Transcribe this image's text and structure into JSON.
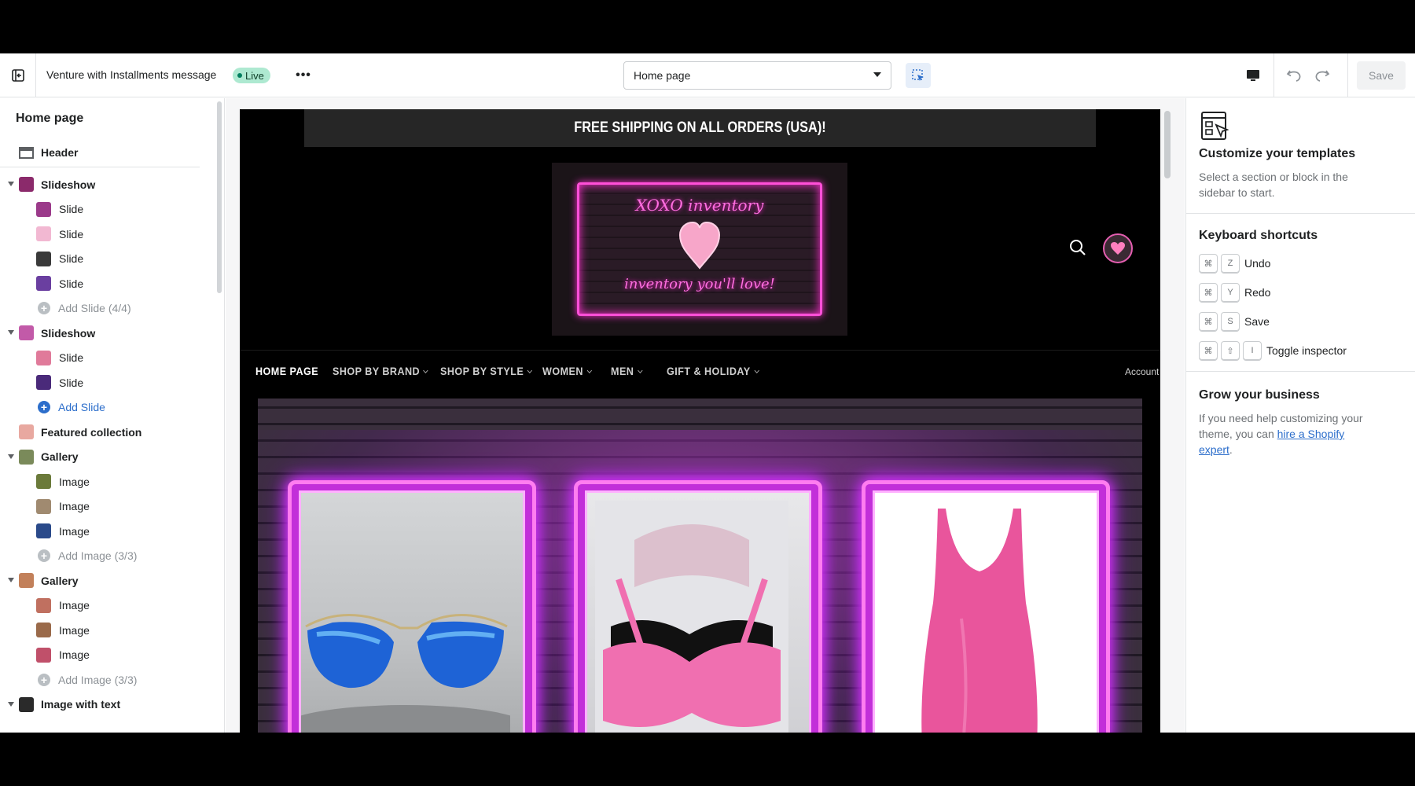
{
  "topbar": {
    "theme_name": "Venture with Installments message",
    "live_label": "Live",
    "more_label": "•••",
    "page_select_value": "Home page",
    "save_label": "Save"
  },
  "sidebar": {
    "title": "Home page",
    "header_label": "Header",
    "rows": [
      {
        "kind": "section",
        "label": "Slideshow",
        "thumb": "#8b2a6b"
      },
      {
        "kind": "child",
        "label": "Slide",
        "thumb": "#9b3a8a"
      },
      {
        "kind": "child",
        "label": "Slide",
        "thumb": "#f2b8d2"
      },
      {
        "kind": "child",
        "label": "Slide",
        "thumb": "#3a3a3a"
      },
      {
        "kind": "child",
        "label": "Slide",
        "thumb": "#6a3fa0"
      },
      {
        "kind": "add",
        "label": "Add Slide (4/4)"
      },
      {
        "kind": "section",
        "label": "Slideshow",
        "thumb": "#c25aa8"
      },
      {
        "kind": "child",
        "label": "Slide",
        "thumb": "#e07a9a"
      },
      {
        "kind": "child",
        "label": "Slide",
        "thumb": "#4a2a7a"
      },
      {
        "kind": "add-blue",
        "label": "Add Slide"
      },
      {
        "kind": "single",
        "label": "Featured collection",
        "thumb": "#e8a8a0"
      },
      {
        "kind": "section",
        "label": "Gallery",
        "thumb": "#7a8a5a"
      },
      {
        "kind": "child",
        "label": "Image",
        "thumb": "#6b7a3a"
      },
      {
        "kind": "child",
        "label": "Image",
        "thumb": "#a08a70"
      },
      {
        "kind": "child",
        "label": "Image",
        "thumb": "#2a4a8a"
      },
      {
        "kind": "add",
        "label": "Add Image (3/3)"
      },
      {
        "kind": "section",
        "label": "Gallery",
        "thumb": "#c2805a"
      },
      {
        "kind": "child",
        "label": "Image",
        "thumb": "#c07060"
      },
      {
        "kind": "child",
        "label": "Image",
        "thumb": "#9a6a4a"
      },
      {
        "kind": "child",
        "label": "Image",
        "thumb": "#c0506a"
      },
      {
        "kind": "add",
        "label": "Add Image (3/3)"
      },
      {
        "kind": "section",
        "label": "Image with text",
        "thumb": "#2a2a2a"
      }
    ]
  },
  "preview": {
    "announcement": "FREE SHIPPING ON ALL ORDERS (USA)!",
    "logo_top": "XOXO inventory",
    "logo_bottom": "inventory you'll love!",
    "nav": [
      {
        "label": "HOME PAGE",
        "dropdown": false
      },
      {
        "label": "SHOP BY BRAND",
        "dropdown": true
      },
      {
        "label": "SHOP BY STYLE",
        "dropdown": true
      },
      {
        "label": "WOMEN",
        "dropdown": true
      },
      {
        "label": "MEN",
        "dropdown": true
      },
      {
        "label": "GIFT & HOLIDAY",
        "dropdown": true
      }
    ],
    "account_label": "Account",
    "banner_items": [
      "sunglasses-image",
      "bra-pack-image",
      "pink-dress-image"
    ]
  },
  "right_panel": {
    "customize_title": "Customize your templates",
    "customize_desc": "Select a section or block in the sidebar to start.",
    "shortcuts_title": "Keyboard shortcuts",
    "shortcuts": [
      {
        "keys": [
          "⌘",
          "Z"
        ],
        "label": "Undo"
      },
      {
        "keys": [
          "⌘",
          "Y"
        ],
        "label": "Redo"
      },
      {
        "keys": [
          "⌘",
          "S"
        ],
        "label": "Save"
      },
      {
        "keys": [
          "⌘",
          "⇧",
          "I"
        ],
        "label": "Toggle inspector"
      }
    ],
    "grow_title": "Grow your business",
    "grow_text_before": "If you need help customizing your theme, you can ",
    "grow_link": "hire a Shopify expert",
    "grow_text_after": "."
  },
  "colors": {
    "live_badge": "#aee9d1",
    "link": "#2c6ecb",
    "neon_pink": "#ff4fd8"
  }
}
